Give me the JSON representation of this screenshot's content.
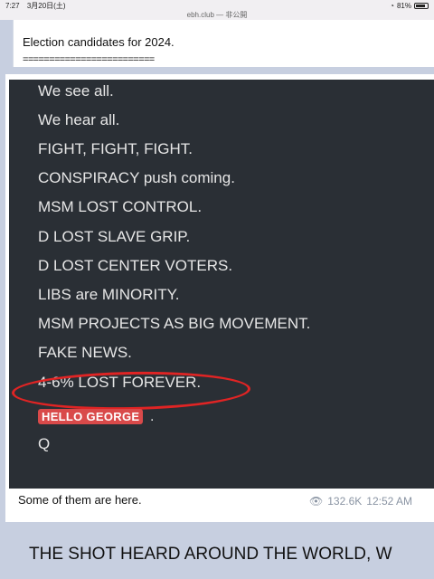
{
  "status_bar": {
    "time": "7:27",
    "date": "3月20日(土)",
    "battery": "81%"
  },
  "browser": {
    "url": "ebh.club — 非公開"
  },
  "top_post": {
    "title": "Election candidates for 2024.",
    "separator": "========================="
  },
  "quote": {
    "lines": [
      "We see all.",
      "We hear all.",
      "FIGHT, FIGHT, FIGHT.",
      "CONSPIRACY push coming.",
      "MSM LOST CONTROL.",
      "D LOST SLAVE GRIP.",
      "D LOST CENTER VOTERS.",
      "LIBS are MINORITY.",
      "MSM PROJECTS AS BIG MOVEMENT.",
      "FAKE NEWS.",
      "4-6% LOST FOREVER."
    ],
    "badge": "HELLO GEORGE",
    "signature": "Q"
  },
  "post_footer": {
    "caption": "Some of them are here.",
    "views": "132.6K",
    "time": "12:52 AM"
  },
  "headline": "THE SHOT HEARD AROUND THE WORLD, W",
  "colors": {
    "dark_bg": "#2a2f35",
    "highlight": "#e02424",
    "badge": "#d94a4a"
  },
  "icons": {
    "views": "eye-icon",
    "wifi": "wifi-icon",
    "battery": "battery-icon"
  }
}
